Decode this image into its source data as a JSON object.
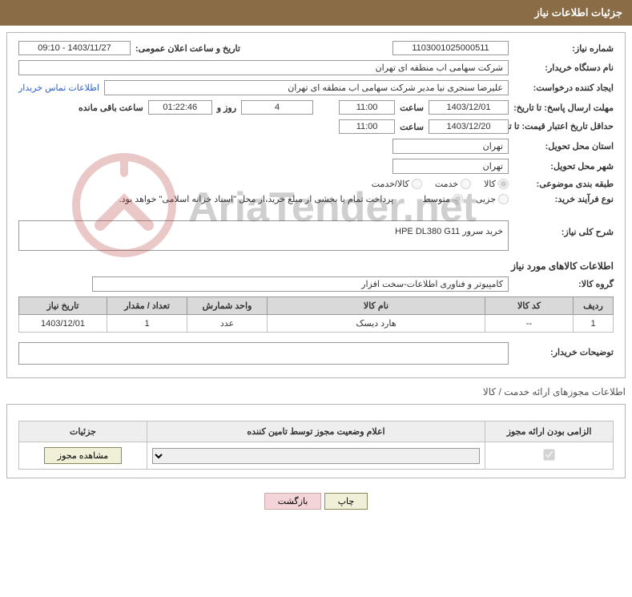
{
  "header_title": "جزئیات اطلاعات نیاز",
  "fields": {
    "need_no_label": "شماره نیاز:",
    "need_no": "1103001025000511",
    "announce_label": "تاریخ و ساعت اعلان عمومی:",
    "announce_value": "1403/11/27 - 09:10",
    "buyer_org_label": "نام دستگاه خریدار:",
    "buyer_org": "شرکت سهامی اب منطقه ای تهران",
    "requester_label": "ایجاد کننده درخواست:",
    "requester": "علیرضا سنجری نیا مدیر شرکت سهامی اب منطقه ای تهران",
    "contact_link": "اطلاعات تماس خریدار",
    "deadline_label": "مهلت ارسال پاسخ: تا تاریخ:",
    "deadline_date": "1403/12/01",
    "time_label": "ساعت",
    "deadline_time": "11:00",
    "days_remain": "4",
    "days_and": "روز و",
    "hms_remain": "01:22:46",
    "remain_suffix": "ساعت باقی مانده",
    "validity_label": "حداقل تاریخ اعتبار قیمت: تا تاریخ:",
    "validity_date": "1403/12/20",
    "validity_time": "11:00",
    "delivery_prov_label": "استان محل تحویل:",
    "delivery_prov": "تهران",
    "delivery_city_label": "شهر محل تحویل:",
    "delivery_city": "تهران",
    "subject_cat_label": "طبقه بندی موضوعی:",
    "cat_goods": "کالا",
    "cat_service": "خدمت",
    "cat_goods_service": "کالا/خدمت",
    "purchase_type_label": "نوع فرآیند خرید:",
    "pt_partial": "جزیی",
    "pt_medium": "متوسط",
    "pt_note": "پرداخت تمام یا بخشی از مبلغ خرید،از محل \"اسناد خزانه اسلامی\" خواهد بود.",
    "overall_desc_label": "شرح کلی نیاز:",
    "overall_desc": "خرید سرور HPE DL380 G11",
    "goods_info_title": "اطلاعات کالاهای مورد نیاز",
    "goods_group_label": "گروه کالا:",
    "goods_group": "کامپیوتر و فناوری اطلاعات-سخت افزار",
    "buyer_notes_label": "توضیحات خریدار:"
  },
  "goods_table": {
    "headers": {
      "row": "ردیف",
      "code": "کد کالا",
      "name": "نام کالا",
      "unit": "واحد شمارش",
      "qty": "تعداد / مقدار",
      "need_date": "تاریخ نیاز"
    },
    "rows": [
      {
        "row": "1",
        "code": "--",
        "name": "هارد دیسک",
        "unit": "عدد",
        "qty": "1",
        "need_date": "1403/12/01"
      }
    ]
  },
  "permit_section_label": "اطلاعات مجوزهای ارائه خدمت / کالا",
  "permit_table": {
    "headers": {
      "mandatory": "الزامی بودن ارائه مجوز",
      "declare": "اعلام وضعیت مجوز توسط تامین کننده",
      "details": "جزئیات"
    },
    "view_btn": "مشاهده مجوز"
  },
  "footer": {
    "print": "چاپ",
    "back": "بازگشت"
  }
}
